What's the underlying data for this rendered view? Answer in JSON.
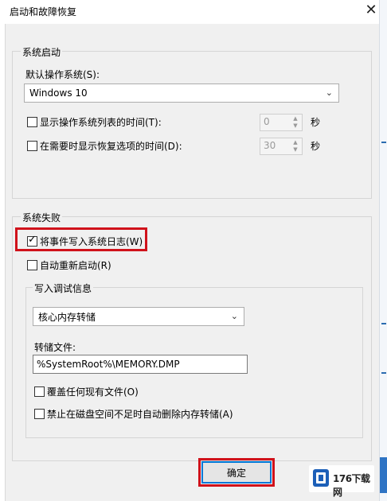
{
  "window": {
    "title": "启动和故障恢复",
    "close_glyph": "✕"
  },
  "system_startup": {
    "group_title": "系统启动",
    "default_os_label": "默认操作系统(S):",
    "default_os_value": "Windows 10",
    "show_list": {
      "label": "显示操作系统列表的时间(T):",
      "checked": false,
      "value": "0",
      "unit": "秒"
    },
    "show_recovery": {
      "label": "在需要时显示恢复选项的时间(D):",
      "checked": false,
      "value": "30",
      "unit": "秒"
    }
  },
  "system_failure": {
    "group_title": "系统失败",
    "write_event": {
      "label": "将事件写入系统日志(W)",
      "checked": true
    },
    "auto_restart": {
      "label": "自动重新启动(R)",
      "checked": false
    },
    "debug_info": {
      "group_title": "写入调试信息",
      "dump_type": "核心内存转储",
      "dump_file_label": "转储文件:",
      "dump_file_value": "%SystemRoot%\\MEMORY.DMP",
      "overwrite": {
        "label": "覆盖任何现有文件(O)",
        "checked": false
      },
      "disable_auto_delete": {
        "label": "禁止在磁盘空间不足时自动删除内存转储(A)",
        "checked": false
      }
    }
  },
  "buttons": {
    "ok_label": "确定"
  },
  "watermark": {
    "text": "176下载网"
  },
  "colors": {
    "highlight": "#d0121b",
    "accent": "#0078d7",
    "dialog_bg": "#f0f0f0"
  },
  "icons": {
    "close": "close-icon",
    "dropdown": "chevron-down-icon",
    "spin": "spin-arrows-icon",
    "check": "checkmark-icon"
  }
}
